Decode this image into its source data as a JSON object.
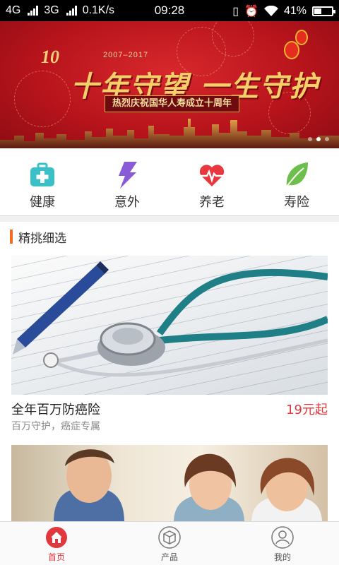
{
  "status_bar": {
    "network1": "4G",
    "network2": "3G",
    "speed": "0.1K/s",
    "time": "09:28",
    "battery": "41%"
  },
  "banner": {
    "logo": "10",
    "years": "2007–2017",
    "slogan": "十年守望 一生守护",
    "subtitle": "热烈庆祝国华人寿成立十周年",
    "slide_count": 3,
    "active_slide": 1
  },
  "categories": [
    {
      "label": "健康",
      "icon": "medical-kit-icon",
      "color": "#3cc0c7"
    },
    {
      "label": "意外",
      "icon": "lightning-icon",
      "color": "#8a5bd6"
    },
    {
      "label": "养老",
      "icon": "heart-pulse-icon",
      "color": "#e8383d"
    },
    {
      "label": "寿险",
      "icon": "leaf-icon",
      "color": "#6cbf4a"
    }
  ],
  "section": {
    "title": "精挑细选",
    "accent": "#f26b21"
  },
  "products": [
    {
      "name": "全年百万防癌险",
      "price": "19元起",
      "desc": "百万守护，癌症专属",
      "image": "stethoscope-on-chart"
    },
    {
      "image": "smiling-young-people"
    }
  ],
  "bottom_nav": [
    {
      "label": "首页",
      "icon": "home-icon",
      "active": true
    },
    {
      "label": "产品",
      "icon": "cube-icon",
      "active": false
    },
    {
      "label": "我的",
      "icon": "user-icon",
      "active": false
    }
  ],
  "colors": {
    "accent_red": "#e0383e",
    "banner_red": "#c4161c"
  }
}
